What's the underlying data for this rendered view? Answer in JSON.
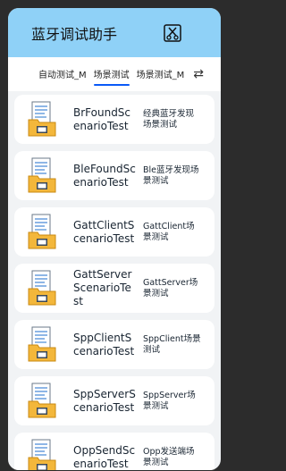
{
  "app": {
    "title": "蓝牙调试助手"
  },
  "tabs": [
    {
      "label": "自动测试_M",
      "active": false
    },
    {
      "label": "场景测试",
      "active": true
    },
    {
      "label": "场景测试_M",
      "active": false
    }
  ],
  "colors": {
    "header_bg": "#8fd1f7",
    "tab_indicator": "#0a59f7"
  },
  "scenarios": [
    {
      "name": "BrFoundScenarioTest",
      "desc": "经典蓝牙发现场景测试"
    },
    {
      "name": "BleFoundScenarioTest",
      "desc": "Ble蓝牙发现场景测试"
    },
    {
      "name": "GattClientScenarioTest",
      "desc": "GattClient场景测试"
    },
    {
      "name": "GattServerScenarioTest",
      "desc": "GattServer场景测试"
    },
    {
      "name": "SppClientScenarioTest",
      "desc": "SppClient场景测试"
    },
    {
      "name": "SppServerScenarioTest",
      "desc": "SppServer场景测试"
    },
    {
      "name": "OppSendScenarioTest",
      "desc": "Opp发送端场景测试"
    }
  ]
}
